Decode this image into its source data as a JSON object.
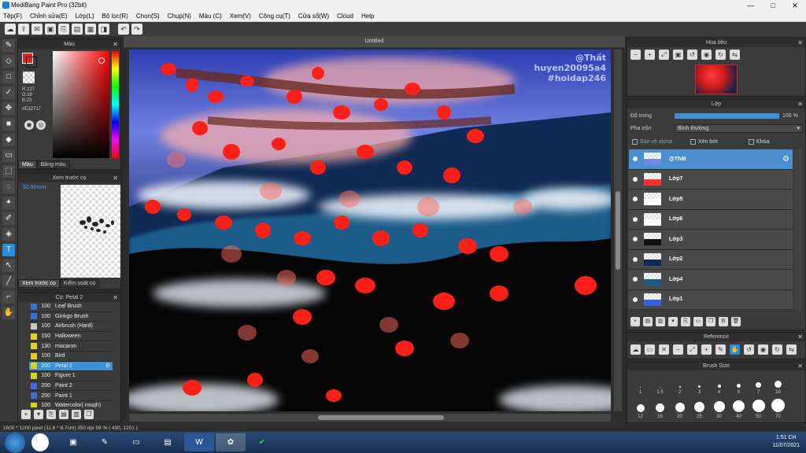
{
  "window": {
    "title": "MediBang Paint Pro (32bit)",
    "controls": [
      "—",
      "□",
      "✕"
    ]
  },
  "menu": [
    "Tệp(F)",
    "Chỉnh sửa(E)",
    "Lớp(L)",
    "Bộ lọc(R)",
    "Chọn(S)",
    "Chụp(N)",
    "Màu (C)",
    "Xem(V)",
    "Công cụ(T)",
    "Cửa sổ(W)",
    "Cloud",
    "Help"
  ],
  "color": {
    "title": "Màu",
    "foreground": "#E32717",
    "rgb_r": "R:227",
    "rgb_g": "G:39",
    "rgb_b": "B:23",
    "hex": "#E32717",
    "tabs": [
      "Màu",
      "Bảng màu"
    ]
  },
  "navigator": {
    "title": "Xem trước cọ",
    "zoom": "50.90mm",
    "tabs": [
      "Xem trước cọ",
      "Kiểm soát cọ"
    ]
  },
  "brush": {
    "title": "Cọ: Petal 2",
    "items": [
      {
        "size": "100",
        "name": "Leaf Brush",
        "color": "#3a6fd8"
      },
      {
        "size": "100",
        "name": "Ginkgo Brush",
        "color": "#3a6fd8"
      },
      {
        "size": "100",
        "name": "Airbrush (Hard)",
        "color": "#c8c8c8"
      },
      {
        "size": "150",
        "name": "Halloween",
        "color": "#e0d020"
      },
      {
        "size": "130",
        "name": "macaron",
        "color": "#e0d020"
      },
      {
        "size": "100",
        "name": "Bird",
        "color": "#e0d020"
      },
      {
        "size": "200",
        "name": "Petal 2",
        "color": "#e0d020"
      },
      {
        "size": "100",
        "name": "Figure 1",
        "color": "#e0d020"
      },
      {
        "size": "200",
        "name": "Paint 2",
        "color": "#3a6fd8"
      },
      {
        "size": "200",
        "name": "Paint 1",
        "color": "#3a6fd8"
      },
      {
        "size": "100",
        "name": "Watercolor( rough)",
        "color": "#e0d020"
      }
    ]
  },
  "document": {
    "tab": "Untitled",
    "watermark": [
      "@Thất",
      "huyen20095a4",
      "#hoidap246"
    ]
  },
  "statusbar": "1600 * 1200 pixel (11.6 * 8.7cm) 350 dpi 59 % ( 430, 1201 )",
  "right_navigator": {
    "title": "Hoa tiêu"
  },
  "layers": {
    "title": "Lớp",
    "opacity_label": "Độ trong",
    "opacity_value": "100 %",
    "blend_label": "Pha trộn",
    "blend_value": "Bình thường",
    "protect_alpha": "Bảo vệ alpha",
    "clipping": "Xén bớt",
    "lock": "Khóa",
    "items": [
      "@Thất",
      "Lớp7",
      "Lớp5",
      "Lớp6",
      "Lớp3",
      "Lớp2",
      "Lớp4",
      "Lớp1"
    ]
  },
  "reference": {
    "title": "Reference"
  },
  "brush_size": {
    "title": "Brush Size",
    "sizes": [
      "1",
      "1.5",
      "2",
      "3",
      "4",
      "5",
      "7",
      "10",
      "12",
      "15",
      "20",
      "25",
      "30",
      "40",
      "50",
      "70"
    ]
  },
  "taskbar": {
    "time": "1:51 CH",
    "date": "11/07/2021"
  }
}
